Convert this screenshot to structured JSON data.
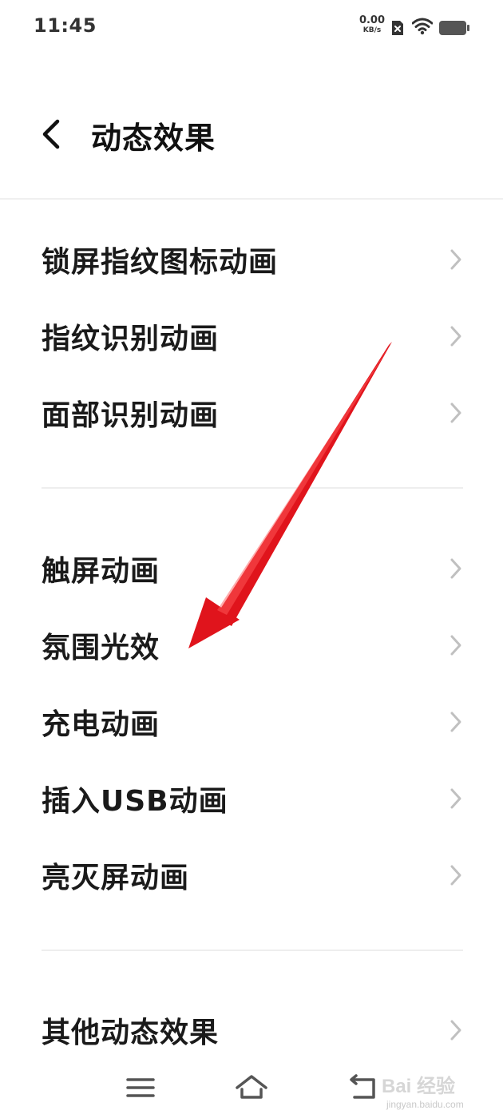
{
  "status_bar": {
    "time": "11:45",
    "net_speed_value": "0.00",
    "net_speed_unit": "KB/s",
    "icons": [
      "sim-x-icon",
      "wifi-icon",
      "battery-icon"
    ]
  },
  "header": {
    "title": "动态效果",
    "back_icon": "chevron-left-icon"
  },
  "sections": [
    {
      "items": [
        {
          "label": "锁屏指纹图标动画"
        },
        {
          "label": "指纹识别动画"
        },
        {
          "label": "面部识别动画"
        }
      ]
    },
    {
      "items": [
        {
          "label": "触屏动画"
        },
        {
          "label": "氛围光效"
        },
        {
          "label": "充电动画"
        },
        {
          "label": "插入USB动画"
        },
        {
          "label": "亮灭屏动画"
        }
      ]
    },
    {
      "items": [
        {
          "label": "其他动态效果"
        }
      ]
    }
  ],
  "nav_bar": {
    "icons": [
      "menu-icon",
      "home-icon",
      "back-return-icon"
    ]
  },
  "watermark": {
    "main": "Bai 经验",
    "sub": "jingyan.baidu.com"
  },
  "colors": {
    "annotation_arrow": "#e0141c",
    "chevron": "#c0c0c0",
    "divider": "#eeeeee"
  }
}
